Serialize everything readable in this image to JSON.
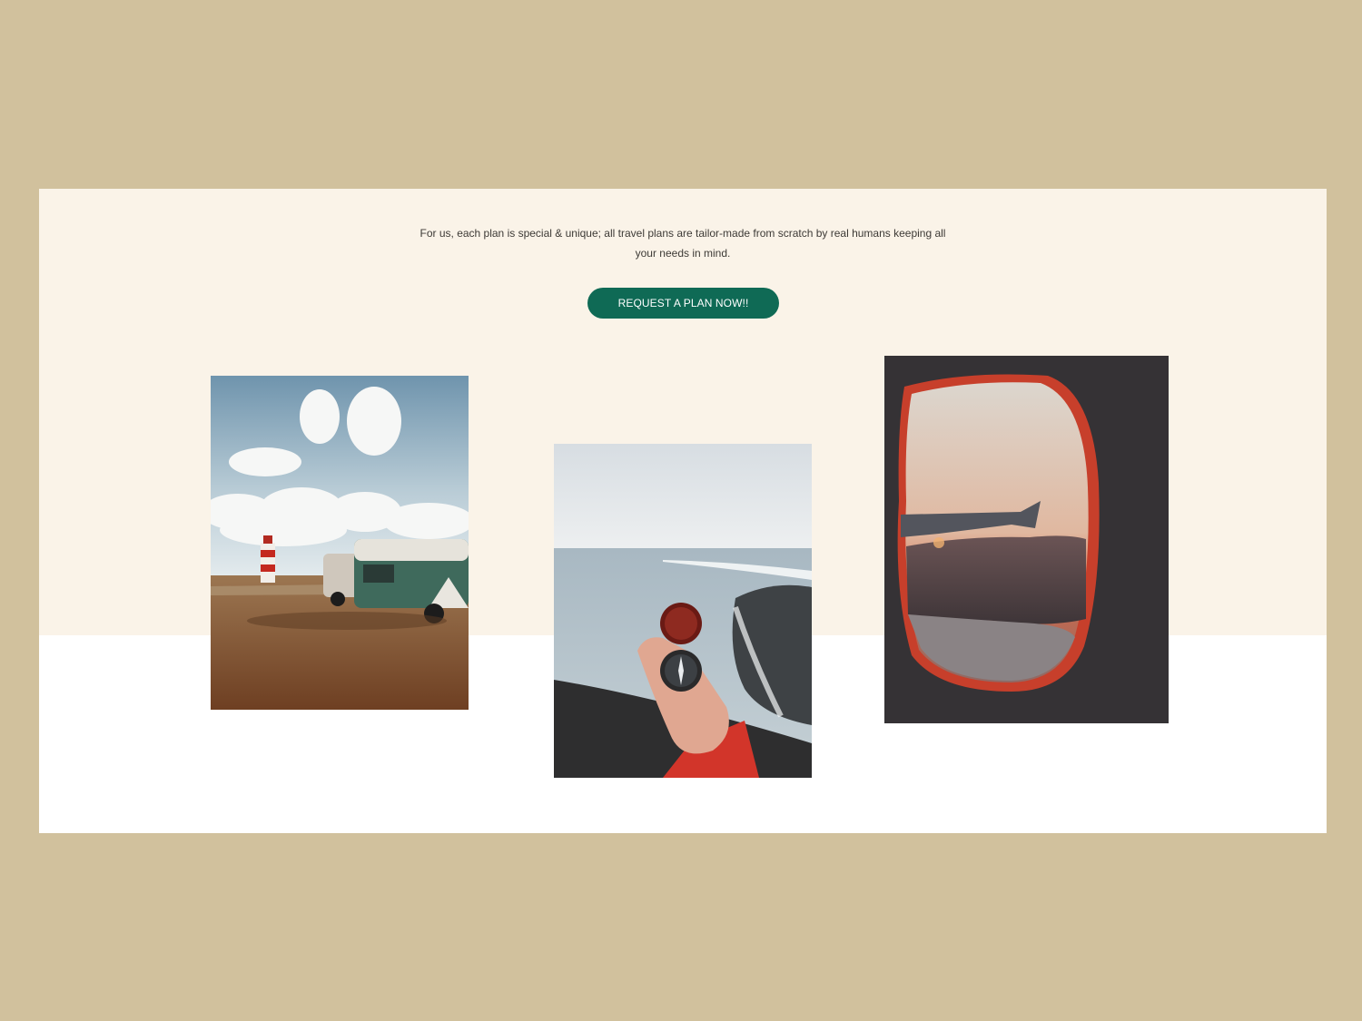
{
  "section": {
    "intro_text": "For us, each plan is special & unique; all travel plans are tailor-made from scratch by real humans keeping all your needs in mind.",
    "cta_label": "REQUEST A PLAN NOW!!"
  },
  "colors": {
    "page_background": "#d1c19d",
    "section_band": "#faf3e8",
    "section_lower": "#ffffff",
    "cta_background": "#0f6a55",
    "cta_text": "#ffffff"
  },
  "photos": [
    {
      "subject": "lighthouse-and-camper-vans"
    },
    {
      "subject": "hand-holding-compass-over-sea"
    },
    {
      "subject": "airplane-window-sunset"
    }
  ]
}
